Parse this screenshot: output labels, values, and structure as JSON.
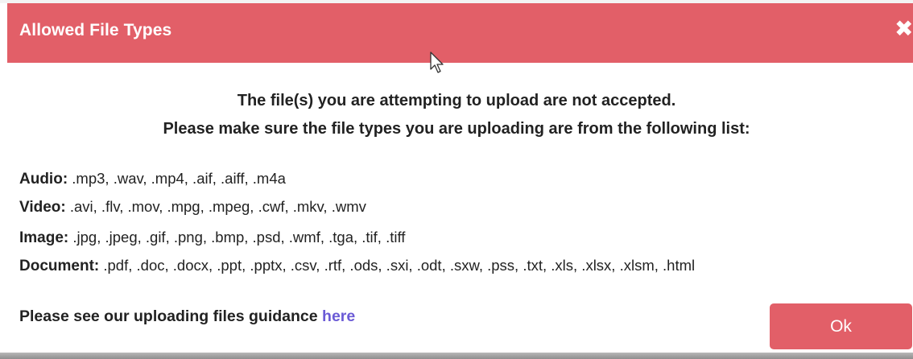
{
  "dialog": {
    "title": "Allowed File Types",
    "close_icon": "close-icon",
    "message_line1": "The file(s) you are attempting to upload are not accepted.",
    "message_line2": "Please make sure the file types you are uploading are from the following list:",
    "file_types": [
      {
        "label": "Audio:",
        "extensions": " .mp3, .wav, .mp4, .aif, .aiff, .m4a"
      },
      {
        "label": "Video:",
        "extensions": " .avi, .flv, .mov, .mpg, .mpeg, .cwf, .mkv, .wmv"
      },
      {
        "label": "Image:",
        "extensions": " .jpg, .jpeg, .gif, .png, .bmp, .psd, .wmf, .tga, .tif, .tiff"
      },
      {
        "label": "Document:",
        "extensions": " .pdf, .doc, .docx, .ppt, .pptx, .csv, .rtf, .ods, .sxi, .odt, .sxw, .pss, .txt, .xls, .xlsx, .xlsm, .html"
      }
    ],
    "guidance_text": "Please see our uploading files guidance ",
    "guidance_link": "here",
    "ok_label": "Ok"
  },
  "colors": {
    "header_bg": "#e25f68",
    "button_bg": "#e25f68",
    "link": "#6b5bd6",
    "text": "#222222"
  },
  "icons": {
    "close": "close-icon",
    "pointer": "mouse-pointer-icon"
  }
}
